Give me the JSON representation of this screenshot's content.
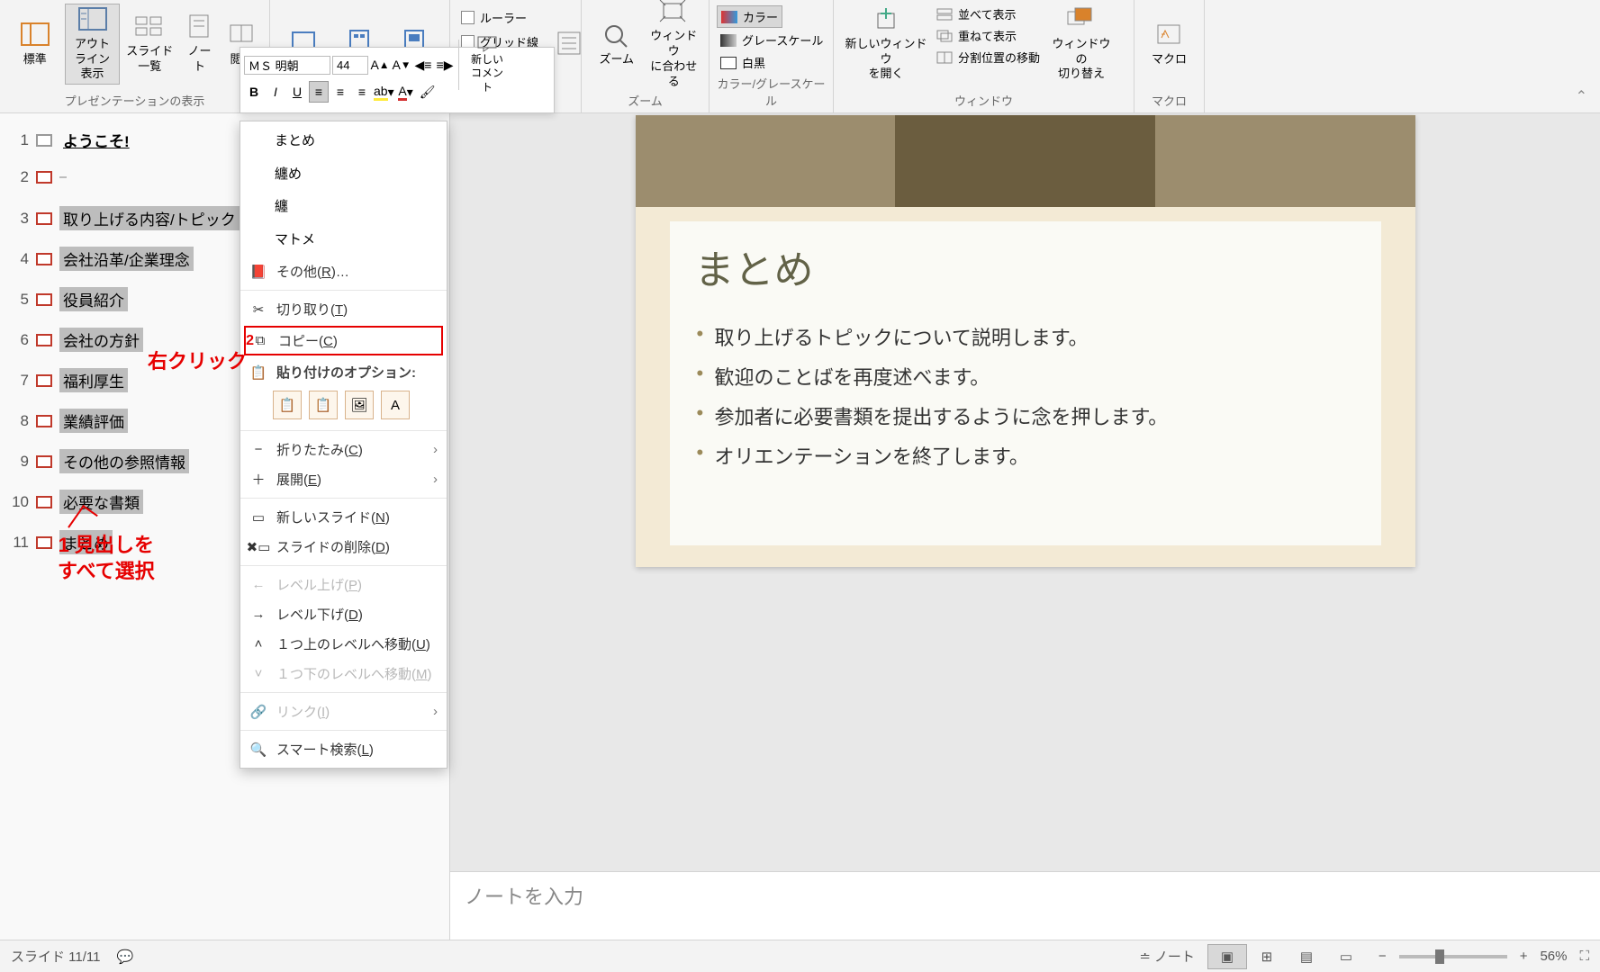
{
  "ribbon": {
    "views": {
      "label": "プレゼンテーションの表示",
      "normal": "標準",
      "outline": "アウトライン\n表示",
      "sorter": "スライド\n一覧",
      "notes": "ノー\nト",
      "reading": "閲覧"
    },
    "show": {
      "ruler": "ルーラー",
      "grid": "グリッド線"
    },
    "zoom": {
      "label": "ズーム",
      "zoom_btn": "ズーム",
      "fit": "ウィンドウ\nに合わせる"
    },
    "color": {
      "label": "カラー/グレースケール",
      "color_btn": "カラー",
      "gray_btn": "グレースケール",
      "bw_btn": "白黒"
    },
    "window": {
      "label": "ウィンドウ",
      "new": "新しいウィンドウ\nを開く",
      "arrange": "並べて表示",
      "cascade": "重ねて表示",
      "split": "分割位置の移動",
      "switch": "ウィンドウの\n切り替え"
    },
    "macro": {
      "label": "マクロ",
      "btn": "マクロ"
    }
  },
  "mini_toolbar": {
    "font": "ＭＳ 明朝",
    "size": "44",
    "comment": "新しい\nコメント"
  },
  "context_menu": {
    "suggest1": "まとめ",
    "suggest2": "纏め",
    "suggest3": "纏",
    "suggest4": "マトメ",
    "other": "その他(R)…",
    "cut": "切り取り(T)",
    "copy": "コピー(C)",
    "paste_header": "貼り付けのオプション:",
    "collapse": "折りたたみ(C)",
    "expand": "展開(E)",
    "new_slide": "新しいスライド(N)",
    "delete_slide": "スライドの削除(D)",
    "promote": "レベル上げ(P)",
    "demote": "レベル下げ(D)",
    "move_up": "１つ上のレベルへ移動(U)",
    "move_down": "１つ下のレベルへ移動(M)",
    "link": "リンク(I)",
    "smart_lookup": "スマート検索(L)"
  },
  "annotations": {
    "right_click": "右クリック",
    "num2": "2",
    "select_all": "1 見出しを\nすべて選択"
  },
  "outline": [
    {
      "n": "1",
      "t": "ようこそ!",
      "first": true
    },
    {
      "n": "2",
      "t": ""
    },
    {
      "n": "3",
      "t": "取り上げる内容/トピック"
    },
    {
      "n": "4",
      "t": "会社沿革/企業理念"
    },
    {
      "n": "5",
      "t": "役員紹介"
    },
    {
      "n": "6",
      "t": "会社の方針"
    },
    {
      "n": "7",
      "t": "福利厚生"
    },
    {
      "n": "8",
      "t": "業績評価"
    },
    {
      "n": "9",
      "t": "その他の参照情報"
    },
    {
      "n": "10",
      "t": "必要な書類"
    },
    {
      "n": "11",
      "t": "まとめ"
    }
  ],
  "slide": {
    "title": "まとめ",
    "bullets": [
      "取り上げるトピックについて説明します。",
      "歓迎のことばを再度述べます。",
      "参加者に必要書類を提出するように念を押します。",
      "オリエンテーションを終了します。"
    ]
  },
  "notes_placeholder": "ノートを入力",
  "status": {
    "slide": "スライド 11/11",
    "notes_btn": "ノート",
    "zoom": "56%"
  }
}
